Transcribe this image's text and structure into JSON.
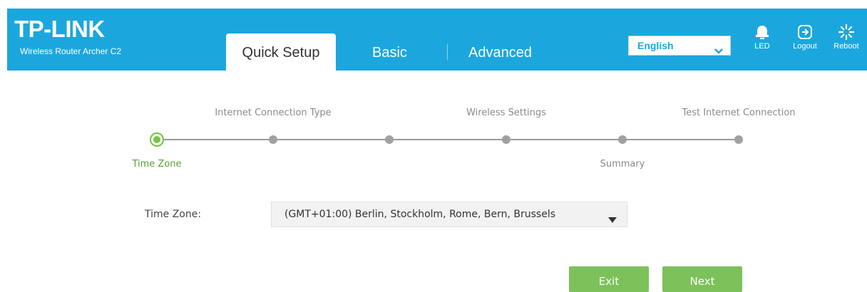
{
  "brand": {
    "name": "TP-LINK",
    "model": "Wireless Router Archer C2"
  },
  "tabs": [
    {
      "label": "Quick Setup",
      "active": true
    },
    {
      "label": "Basic",
      "active": false
    },
    {
      "label": "Advanced",
      "active": false
    }
  ],
  "language": {
    "selected": "English"
  },
  "header_buttons": {
    "led": "LED",
    "logout": "Logout",
    "reboot": "Reboot"
  },
  "steps": [
    {
      "label": "Time Zone",
      "current": true
    },
    {
      "label": "Internet Connection Type",
      "current": false
    },
    {
      "label": "",
      "current": false
    },
    {
      "label": "Wireless Settings",
      "current": false
    },
    {
      "label": "Summary",
      "current": false
    },
    {
      "label": "Test Internet Connection",
      "current": false
    }
  ],
  "form": {
    "time_zone_label": "Time Zone:",
    "time_zone_value": "(GMT+01:00) Berlin, Stockholm, Rome, Bern, Brussels"
  },
  "buttons": {
    "exit": "Exit",
    "next": "Next"
  },
  "colors": {
    "header": "#1ba7de",
    "accent_green": "#78c247",
    "button_green": "#7cc15a"
  },
  "icons": [
    "chevron-down-icon",
    "bell-icon",
    "logout-icon",
    "reboot-icon",
    "caret-down-icon"
  ]
}
